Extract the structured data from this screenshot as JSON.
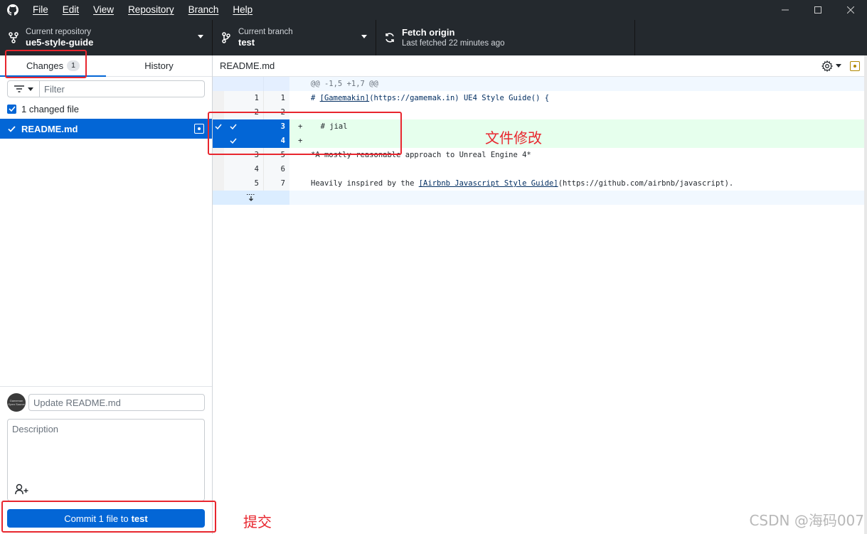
{
  "menu": {
    "file": "File",
    "edit": "Edit",
    "view": "View",
    "repository": "Repository",
    "branch": "Branch",
    "help": "Help"
  },
  "toolbar": {
    "repo_label": "Current repository",
    "repo_value": "ue5-style-guide",
    "branch_label": "Current branch",
    "branch_value": "test",
    "fetch_label": "Fetch origin",
    "fetch_status": "Last fetched 22 minutes ago"
  },
  "sidebar": {
    "tab_changes": "Changes",
    "tab_changes_count": "1",
    "tab_history": "History",
    "filter_placeholder": "Filter",
    "changed_files_label": "1 changed file",
    "file_name": "README.md",
    "summary_placeholder": "Update README.md",
    "description_placeholder": "Description",
    "avatar_text": "Gameman Open Source",
    "commit_prefix": "Commit 1 file to",
    "commit_branch": "test"
  },
  "diff": {
    "file_name": "README.md",
    "hunk_header": "@@ -1,5 +1,7 @@",
    "lines": [
      {
        "old": "1",
        "new": "1",
        "prefix": "",
        "code_a": "# ",
        "code_link": "[Gamemakin]",
        "code_b": "(https://gamemak.in) UE4 Style Guide() {"
      },
      {
        "old": "2",
        "new": "2",
        "code": ""
      },
      {
        "old": "",
        "new": "3",
        "code": "+    # jial"
      },
      {
        "old": "",
        "new": "4",
        "code": "+"
      },
      {
        "old": "3",
        "new": "5",
        "code": "*A mostly reasonable approach to Unreal Engine 4*"
      },
      {
        "old": "4",
        "new": "6",
        "code": ""
      },
      {
        "old": "5",
        "new": "7",
        "code_a": "Heavily inspired by the ",
        "code_link": "[Airbnb Javascript Style Guide]",
        "code_b": "(https://github.com/airbnb/javascript)."
      }
    ]
  },
  "annotations": {
    "file_modified": "文件修改",
    "commit": "提交",
    "watermark": "CSDN @海码007"
  },
  "colors": {
    "accent": "#0366d6",
    "titlebar": "#24292e",
    "annotation": "#e8262e",
    "added_bg": "#e6ffed"
  }
}
